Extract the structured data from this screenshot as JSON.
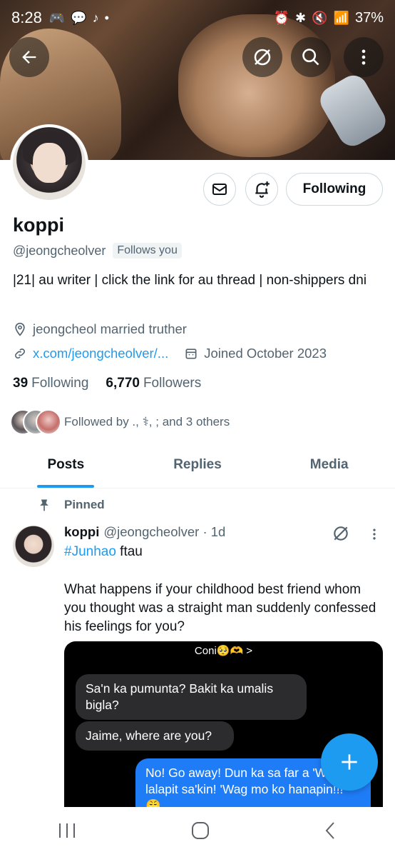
{
  "status_bar": {
    "time": "8:28",
    "battery": "37%"
  },
  "profile": {
    "display_name": "koppi",
    "handle": "@jeongcheolver",
    "follows_you": "Follows you",
    "bio": "|21|  au writer | click the link for au thread | non-shippers dni",
    "location": "jeongcheol married truther",
    "link": "x.com/jeongcheolver/...",
    "joined": "Joined October 2023",
    "following_count": "39",
    "following_label": "Following",
    "followers_count": "6,770",
    "followers_label": "Followers",
    "followed_by": "Followed by ., ⚕, ; and 3 others",
    "following_button": "Following"
  },
  "tabs": [
    {
      "label": "Posts",
      "active": true
    },
    {
      "label": "Replies",
      "active": false
    },
    {
      "label": "Media",
      "active": false
    }
  ],
  "post": {
    "pinned_label": "Pinned",
    "name": "koppi",
    "handle_time": "@jeongcheolver · 1d",
    "hashtag": "#Junhao",
    "hashtag_suffix": " ftau",
    "text": "What happens if your childhood best friend whom you thought was a straight man suddenly confessed his feelings for you?",
    "chat": {
      "title": "Coni🥺🫶 >",
      "messages": [
        {
          "side": "in",
          "text": "Sa'n ka pumunta? Bakit ka umalis bigla?"
        },
        {
          "side": "in",
          "text": "Jaime, where are you?"
        },
        {
          "side": "out",
          "text": "No! Go away! Dun ka sa far a 'Wag ka lalapit sa'kin! 'Wag mo ko hanapin!!! 😤"
        }
      ]
    }
  },
  "colors": {
    "accent": "#1d9bf0",
    "secondary_text": "#536471",
    "border": "#cfd9de"
  }
}
